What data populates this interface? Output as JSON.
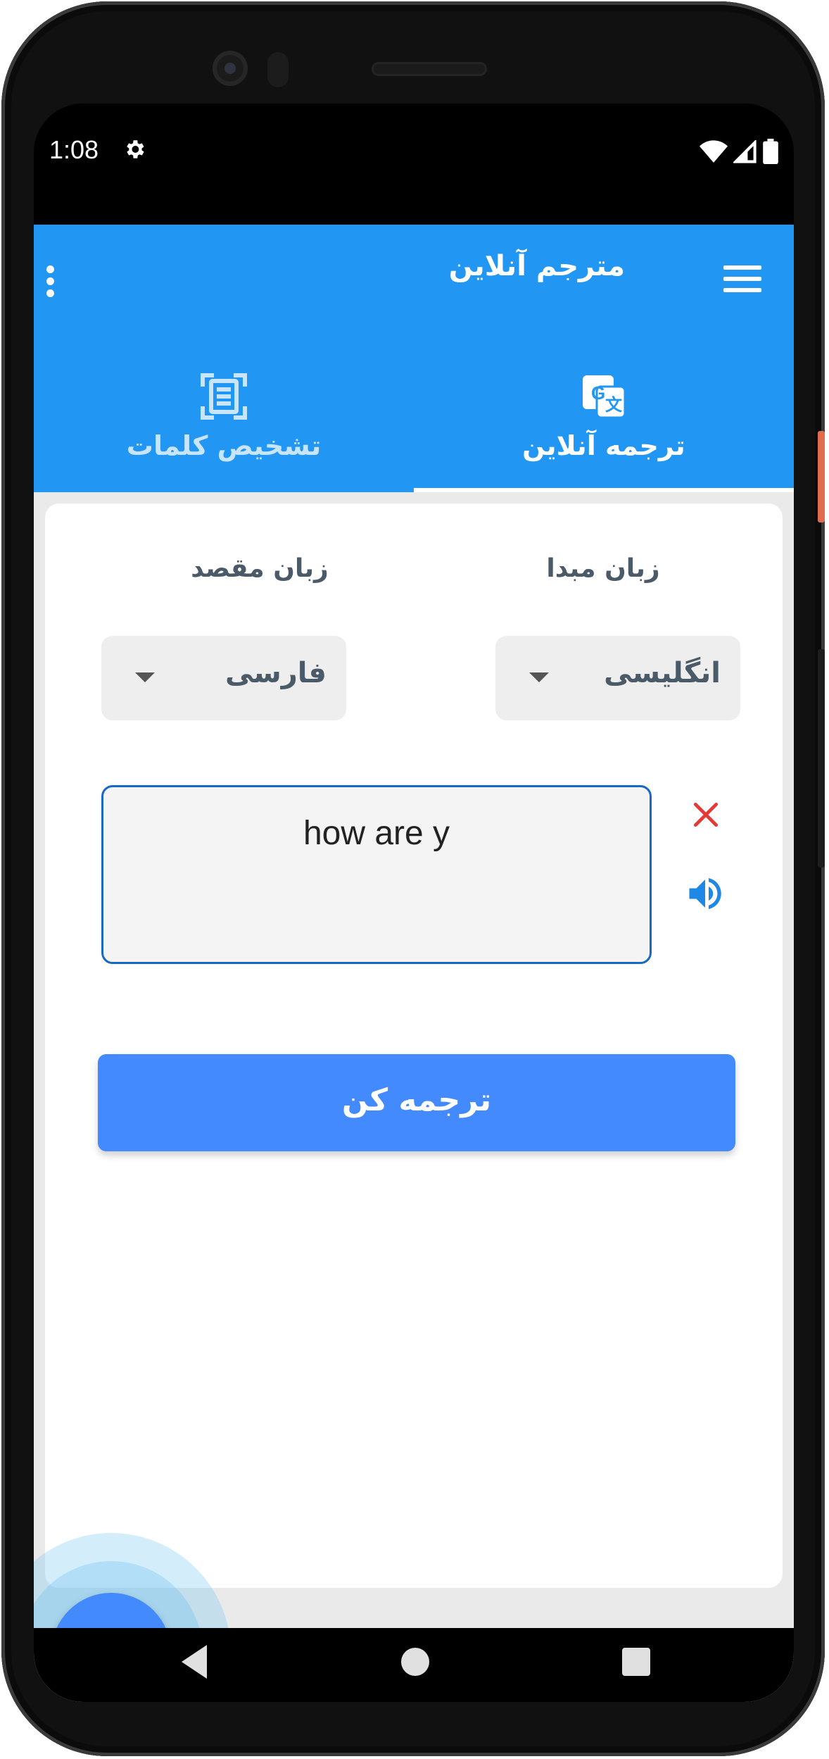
{
  "status_bar": {
    "time": "1:08",
    "icons": [
      "settings-icon",
      "wifi-icon",
      "signal-icon",
      "battery-icon"
    ]
  },
  "app_bar": {
    "title": "مترجم آنلاین",
    "menu_icon": "hamburger-icon",
    "overflow_icon": "more-vertical-icon"
  },
  "tabs": [
    {
      "label": "ترجمه آنلاین",
      "icon": "google-translate-icon",
      "selected": true
    },
    {
      "label": "تشخیص کلمات",
      "icon": "document-scan-icon",
      "selected": false
    }
  ],
  "translator": {
    "source_label": "زبان مبدا",
    "target_label": "زبان مقصد",
    "source_language": "انگلیسی",
    "target_language": "فارسی",
    "input_text": "how are y",
    "translate_button": "ترجمه کن"
  },
  "colors": {
    "primary": "#2196f3",
    "button": "#448aff",
    "input_border": "#1769c4",
    "clear_icon": "#e53935",
    "speaker_icon": "#1e88e5"
  }
}
